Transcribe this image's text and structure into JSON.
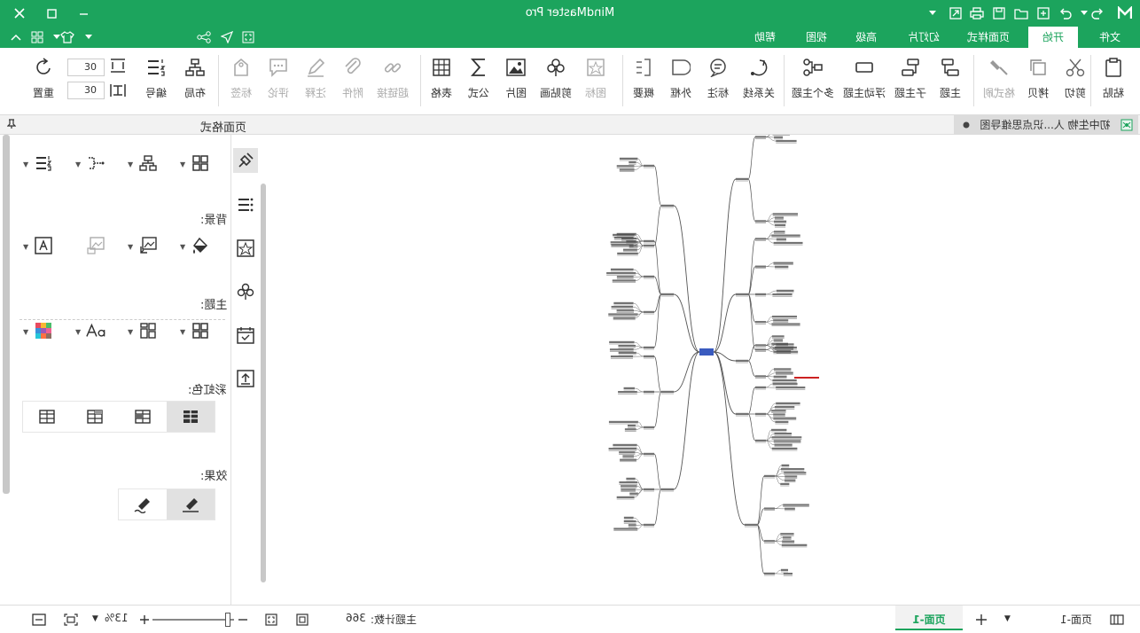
{
  "window": {
    "title": "MindMaster Pro"
  },
  "tabs": [
    {
      "label": "文件",
      "active": false
    },
    {
      "label": "开始",
      "active": true
    },
    {
      "label": "页面样式",
      "active": false
    },
    {
      "label": "幻灯片",
      "active": false
    },
    {
      "label": "高级",
      "active": false
    },
    {
      "label": "视图",
      "active": false
    },
    {
      "label": "帮助",
      "active": false
    }
  ],
  "ribbon": {
    "paste": "粘贴",
    "cut": "剪切",
    "copy": "拷贝",
    "format_painter": "格式刷",
    "topic": "主题",
    "subtopic": "子主题",
    "floating_topic": "浮动主题",
    "multiple_topics": "多个主题",
    "relationship": "关系线",
    "callout": "标注",
    "boundary": "外框",
    "summary": "概要",
    "icon": "图标",
    "clipart": "剪贴画",
    "image": "图片",
    "formula": "公式",
    "table": "表格",
    "hyperlink": "超链接",
    "attachment": "附件",
    "note": "注释",
    "comment": "评论",
    "tag": "标签",
    "layout": "布局",
    "numbering": "编号",
    "spacing_h": "30",
    "spacing_v": "30",
    "reset": "重置"
  },
  "document": {
    "tab_title": "初中生物 人...识点思维导图"
  },
  "side_panel": {
    "title": "页面格式",
    "background_label": "背景:",
    "theme_label": "主题:",
    "rainbow_label": "彩虹色:",
    "effect_label": "效果:"
  },
  "status": {
    "page_tab": "页面-1",
    "page_label": "页面-1",
    "topic_count_label": "主题计数:",
    "topic_count": "366",
    "zoom": "13%"
  },
  "colors": {
    "brand": "#1ca45d",
    "central_topic": "#3a5bbf",
    "red_text": "#cc2222"
  }
}
